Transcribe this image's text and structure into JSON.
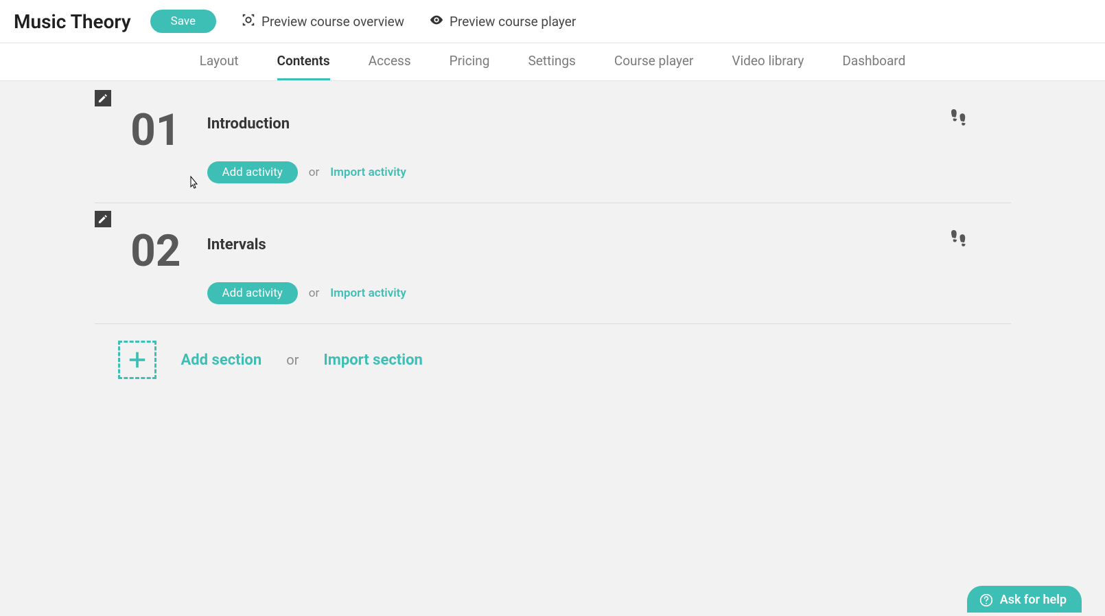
{
  "header": {
    "title": "Music Theory",
    "save_label": "Save",
    "preview_overview": "Preview course overview",
    "preview_player": "Preview course player"
  },
  "tabs": [
    "Layout",
    "Contents",
    "Access",
    "Pricing",
    "Settings",
    "Course player",
    "Video library",
    "Dashboard"
  ],
  "active_tab": "Contents",
  "sections": [
    {
      "number": "01",
      "title": "Introduction",
      "add_activity": "Add activity",
      "or": "or",
      "import_activity": "Import activity"
    },
    {
      "number": "02",
      "title": "Intervals",
      "add_activity": "Add activity",
      "or": "or",
      "import_activity": "Import activity"
    }
  ],
  "add_section": {
    "add_label": "Add section",
    "or": "or",
    "import_label": "Import section"
  },
  "help": {
    "label": "Ask for help"
  }
}
